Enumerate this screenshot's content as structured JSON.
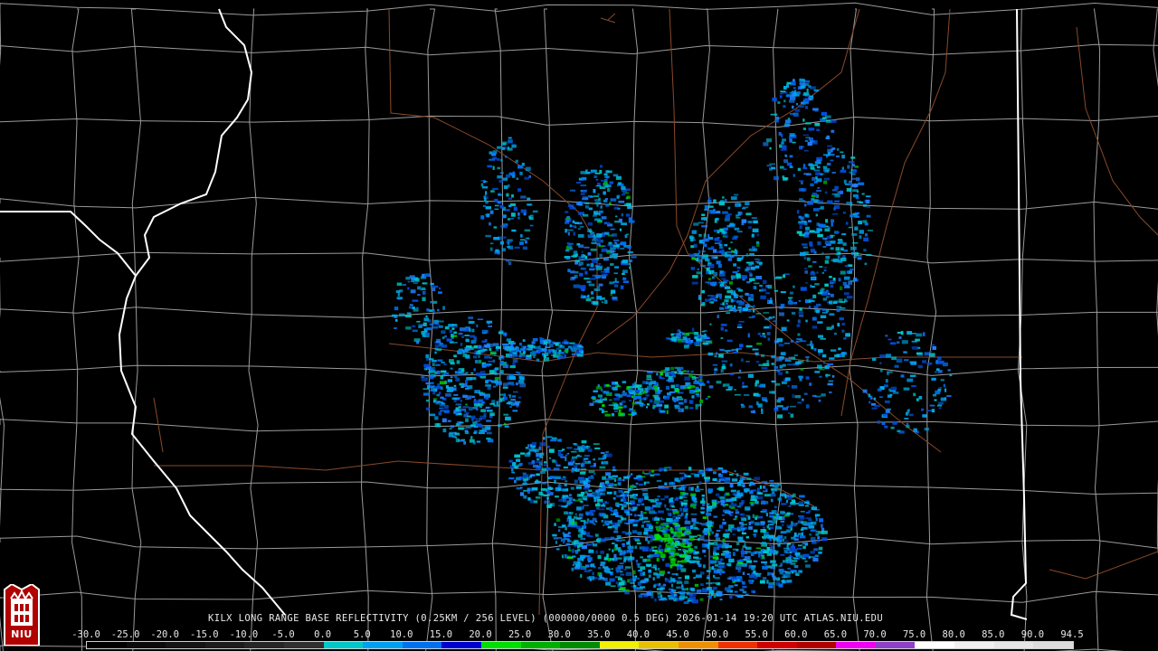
{
  "caption": {
    "text": "KILX LONG RANGE BASE REFLECTIVITY (0.25KM / 256 LEVEL) (000000/0000 0.5 DEG) 2026-01-14 19:20 UTC  ATLAS.NIU.EDU"
  },
  "logo": {
    "text": "NIU",
    "icon": "niu-tower-logo"
  },
  "colors": {
    "background": "#000000",
    "county_lines": "#9a9a9a",
    "state_lines": "#ffffff",
    "highways": "#8a4a2a"
  },
  "scale": {
    "labels": [
      "-30.0",
      "-25.0",
      "-20.0",
      "-15.0",
      "-10.0",
      "-5.0",
      "0.0",
      "5.0",
      "10.0",
      "15.0",
      "20.0",
      "25.0",
      "30.0",
      "35.0",
      "40.0",
      "45.0",
      "50.0",
      "55.0",
      "60.0",
      "65.0",
      "70.0",
      "75.0",
      "80.0",
      "85.0",
      "90.0",
      "94.5"
    ],
    "colors": [
      "#000000",
      "#0b0b0b",
      "#141414",
      "#1c1c1c",
      "#262626",
      "#303030",
      "#00c8c8",
      "#00a0f0",
      "#0070f0",
      "#0000d0",
      "#00e000",
      "#00b000",
      "#008c00",
      "#f0f000",
      "#e8c000",
      "#f09000",
      "#f03000",
      "#d00000",
      "#b00000",
      "#f000f0",
      "#9040c8",
      "#ffffff",
      "#f0f0f0",
      "#e6e6e6",
      "#dcdcdc"
    ]
  }
}
